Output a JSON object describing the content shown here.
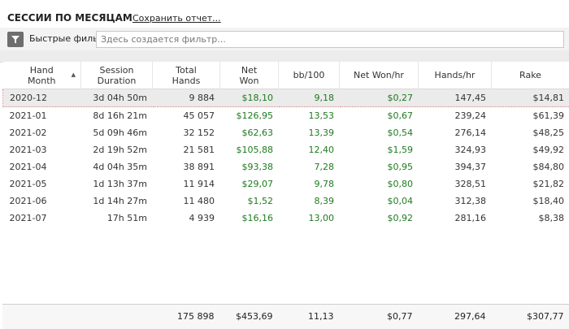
{
  "header": {
    "title": "СЕССИИ ПО МЕСЯЦАМ",
    "save_report": "Сохранить отчет..."
  },
  "filter": {
    "label": "Быстрые фильтры",
    "placeholder": "Здесь создается фильтр...",
    "icon": "funnel-icon"
  },
  "columns": [
    {
      "line1": "Hand",
      "line2": "Month"
    },
    {
      "line1": "Session",
      "line2": "Duration"
    },
    {
      "line1": "Total",
      "line2": "Hands"
    },
    {
      "line1": "Net",
      "line2": "Won"
    },
    {
      "line1": "bb/100",
      "line2": ""
    },
    {
      "line1": "Net Won/hr",
      "line2": ""
    },
    {
      "line1": "Hands/hr",
      "line2": ""
    },
    {
      "line1": "Rake",
      "line2": ""
    }
  ],
  "sort": {
    "column": "Hand Month",
    "direction": "ascending"
  },
  "rows": [
    {
      "month": "2020-12",
      "duration": "3d 04h 50m",
      "hands": "9 884",
      "net_won": "$18,10",
      "bb100": "9,18",
      "net_won_hr": "$0,27",
      "hands_hr": "147,45",
      "rake": "$14,81",
      "selected": true
    },
    {
      "month": "2021-01",
      "duration": "8d 16h 21m",
      "hands": "45 057",
      "net_won": "$126,95",
      "bb100": "13,53",
      "net_won_hr": "$0,67",
      "hands_hr": "239,24",
      "rake": "$61,39"
    },
    {
      "month": "2021-02",
      "duration": "5d 09h 46m",
      "hands": "32 152",
      "net_won": "$62,63",
      "bb100": "13,39",
      "net_won_hr": "$0,54",
      "hands_hr": "276,14",
      "rake": "$48,25"
    },
    {
      "month": "2021-03",
      "duration": "2d 19h 52m",
      "hands": "21 581",
      "net_won": "$105,88",
      "bb100": "12,40",
      "net_won_hr": "$1,59",
      "hands_hr": "324,93",
      "rake": "$49,92"
    },
    {
      "month": "2021-04",
      "duration": "4d 04h 35m",
      "hands": "38 891",
      "net_won": "$93,38",
      "bb100": "7,28",
      "net_won_hr": "$0,95",
      "hands_hr": "394,37",
      "rake": "$84,80"
    },
    {
      "month": "2021-05",
      "duration": "1d 13h 37m",
      "hands": "11 914",
      "net_won": "$29,07",
      "bb100": "9,78",
      "net_won_hr": "$0,80",
      "hands_hr": "328,51",
      "rake": "$21,82"
    },
    {
      "month": "2021-06",
      "duration": "1d 14h 27m",
      "hands": "11 480",
      "net_won": "$1,52",
      "bb100": "8,39",
      "net_won_hr": "$0,04",
      "hands_hr": "312,38",
      "rake": "$18,40"
    },
    {
      "month": "2021-07",
      "duration": "17h 51m",
      "hands": "4 939",
      "net_won": "$16,16",
      "bb100": "13,00",
      "net_won_hr": "$0,92",
      "hands_hr": "281,16",
      "rake": "$8,38"
    }
  ],
  "totals": {
    "month": "",
    "duration": "",
    "hands": "175 898",
    "net_won": "$453,69",
    "bb100": "11,13",
    "net_won_hr": "$0,77",
    "hands_hr": "297,64",
    "rake": "$307,77"
  },
  "colors": {
    "positive": "#1f7a1f",
    "text": "#333333",
    "selection_border": "#d98a8a",
    "selection_bg": "#ebebeb",
    "filter_button": "#6e6e6e"
  }
}
